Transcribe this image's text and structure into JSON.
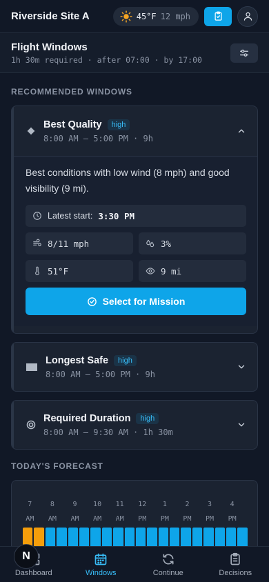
{
  "header": {
    "site_name": "Riverside Site A",
    "temperature": "45°F",
    "wind": "12 mph"
  },
  "flight_windows": {
    "title": "Flight Windows",
    "subtitle": "1h 30m required · after 07:00 · by 17:00"
  },
  "recommended": {
    "section_label": "RECOMMENDED WINDOWS",
    "cards": [
      {
        "title": "Best Quality",
        "badge": "high",
        "time": "8:00 AM – 5:00 PM · 9h",
        "expanded": true,
        "description": "Best conditions with low wind (8 mph) and good visibility (9 mi).",
        "latest_label": "Latest start:",
        "latest_value": "3:30 PM",
        "wind": "8/11 mph",
        "precip": "3%",
        "temp": "51°F",
        "visibility": "9 mi",
        "select_label": "Select for Mission"
      },
      {
        "title": "Longest Safe",
        "badge": "high",
        "time": "8:00 AM – 5:00 PM · 9h",
        "expanded": false
      },
      {
        "title": "Required Duration",
        "badge": "high",
        "time": "8:00 AM – 9:30 AM · 1h 30m",
        "expanded": false
      }
    ]
  },
  "forecast": {
    "section_label": "TODAY'S FORECAST",
    "hours": [
      {
        "h": "7",
        "p": "AM"
      },
      {
        "h": "8",
        "p": "AM"
      },
      {
        "h": "9",
        "p": "AM"
      },
      {
        "h": "10",
        "p": "AM"
      },
      {
        "h": "11",
        "p": "AM"
      },
      {
        "h": "12",
        "p": "PM"
      },
      {
        "h": "1",
        "p": "PM"
      },
      {
        "h": "2",
        "p": "PM"
      },
      {
        "h": "3",
        "p": "PM"
      },
      {
        "h": "4",
        "p": "PM"
      }
    ],
    "bar_status": [
      "amber",
      "amber",
      "blue",
      "blue",
      "blue",
      "blue",
      "blue",
      "blue",
      "blue",
      "blue",
      "blue",
      "blue",
      "blue",
      "blue",
      "blue",
      "blue",
      "blue",
      "blue",
      "blue",
      "blue"
    ],
    "colors": {
      "amber": "#f59e0b",
      "blue": "#0ea5e9"
    }
  },
  "nav": {
    "items": [
      {
        "label": "Dashboard",
        "icon": "dashboard-icon",
        "active": false
      },
      {
        "label": "Windows",
        "icon": "calendar-icon",
        "active": true
      },
      {
        "label": "Continue",
        "icon": "refresh-icon",
        "active": false
      },
      {
        "label": "Decisions",
        "icon": "clipboard-icon",
        "active": false
      }
    ],
    "floating_badge": "N"
  },
  "colors": {
    "accent": "#0ea5e9",
    "background": "#111826",
    "card": "#1b2331"
  }
}
